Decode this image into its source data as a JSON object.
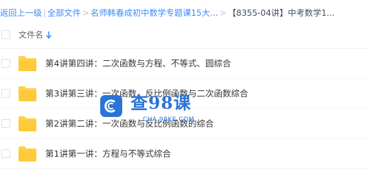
{
  "breadcrumb": {
    "back": "返回上一级",
    "separator": "|",
    "all_files": "全部文件",
    "arrow": ">",
    "folder": "名师韩春成初中数学专题课15大...",
    "current": "【8355-04讲】中考数学1..."
  },
  "header": {
    "name_label": "文件名",
    "sort_icon": "arrow-down-icon"
  },
  "rows": [
    {
      "name": "第4讲第四讲：二次函数与方程、不等式、圆综合",
      "icon": "folder-icon"
    },
    {
      "name": "第3讲第三讲：一次函数、反比例函数与二次函数综合",
      "icon": "folder-icon"
    },
    {
      "name": "第2讲第二讲：一次函数与反比例函数的综合",
      "icon": "folder-icon"
    },
    {
      "name": "第1讲第一讲：方程与不等式综合",
      "icon": "folder-icon"
    }
  ],
  "watermark": {
    "title": "查98课",
    "url": "CHA.98KE.COM"
  },
  "colors": {
    "link": "#3b8cff",
    "folder": "#ffd04b",
    "watermark": "#2a74d8"
  }
}
